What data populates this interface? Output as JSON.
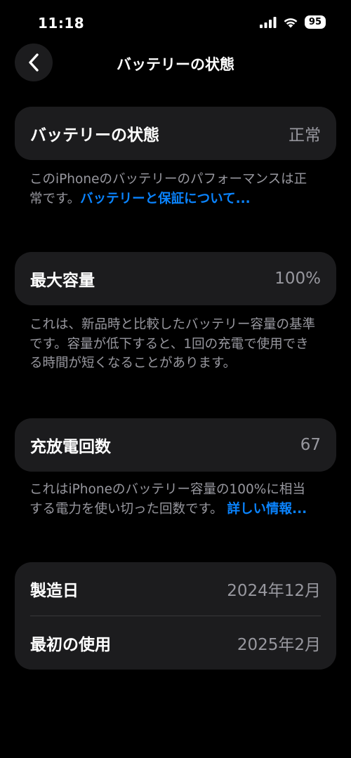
{
  "status_bar": {
    "time": "11:18",
    "battery_percent": "95"
  },
  "nav": {
    "title": "バッテリーの状態"
  },
  "battery_health": {
    "label": "バッテリーの状態",
    "value": "正常",
    "description": "このiPhoneのバッテリーのパフォーマンスは正常です。",
    "link": "バッテリーと保証について..."
  },
  "max_capacity": {
    "label": "最大容量",
    "value": "100%",
    "description": "これは、新品時と比較したバッテリー容量の基準です。容量が低下すると、1回の充電で使用できる時間が短くなることがあります。"
  },
  "cycle_count": {
    "label": "充放電回数",
    "value": "67",
    "description": "これはiPhoneのバッテリー容量の100%に相当する電力を使い切った回数です。",
    "link": "詳しい情報..."
  },
  "dates": {
    "manufacture_label": "製造日",
    "manufacture_value": "2024年12月",
    "first_use_label": "最初の使用",
    "first_use_value": "2025年2月"
  },
  "colors": {
    "background": "#000000",
    "card": "#1c1c1e",
    "secondary_text": "#98989f",
    "link": "#0a84ff"
  }
}
